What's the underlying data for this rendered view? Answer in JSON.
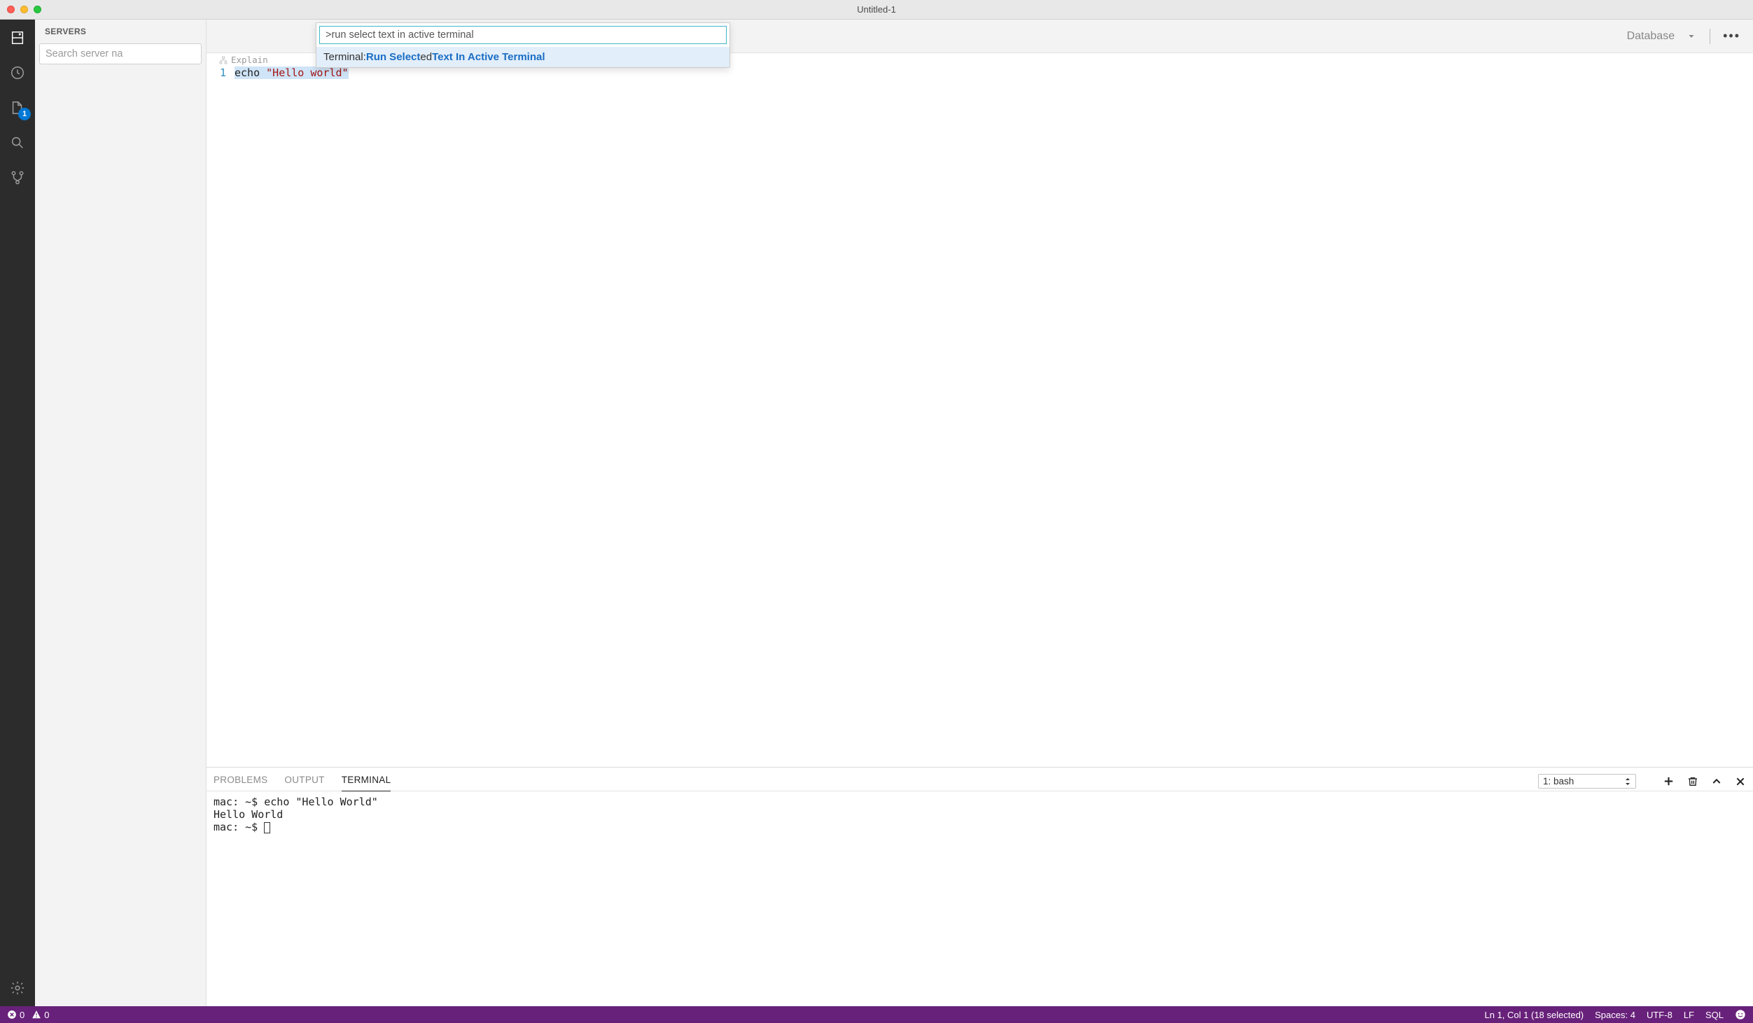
{
  "window": {
    "title": "Untitled-1"
  },
  "sidebar": {
    "header": "SERVERS",
    "search_placeholder": "Search server na"
  },
  "activity": {
    "files_badge": "1"
  },
  "editor_topbar": {
    "database_label": "Database",
    "more_label": "•••"
  },
  "palette": {
    "input": ">run select text in active terminal",
    "item": {
      "prefix_plain": "Terminal: ",
      "seg1_hl": "Run Select",
      "seg2_plain": "ed ",
      "seg3_hl": "Text In Active Terminal"
    }
  },
  "editor": {
    "codelens": "Explain",
    "line_number": "1",
    "code": {
      "token1": "echo ",
      "token2": "\"Hello world\""
    }
  },
  "panel": {
    "tabs": {
      "problems": "PROBLEMS",
      "output": "OUTPUT",
      "terminal": "TERMINAL"
    },
    "terminal_select": "1: bash",
    "body": {
      "line1": "mac: ~$ echo \"Hello World\"",
      "line2": "Hello World",
      "line3_prompt": "mac: ~$ "
    }
  },
  "status": {
    "errors": "0",
    "warnings": "0",
    "cursor": "Ln 1, Col 1 (18 selected)",
    "spaces": "Spaces: 4",
    "encoding": "UTF-8",
    "eol": "LF",
    "lang": "SQL"
  }
}
